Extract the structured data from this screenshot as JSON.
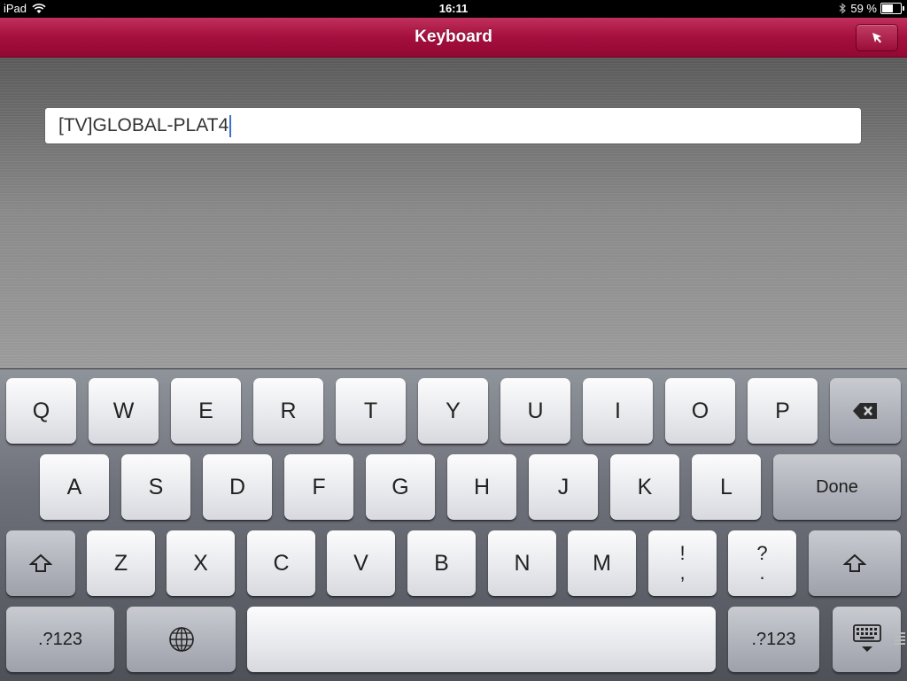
{
  "status_bar": {
    "device": "iPad",
    "time": "16:11",
    "battery_percent": "59 %",
    "battery_level": 0.59,
    "icons": [
      "wifi-icon",
      "bluetooth-icon",
      "battery-icon"
    ]
  },
  "title_bar": {
    "title": "Keyboard",
    "accent": "#a40f3e",
    "pointer_button_icon": "cursor-arrow-icon"
  },
  "text_field": {
    "value": "[TV]GLOBAL-PLAT4"
  },
  "keyboard": {
    "row1": [
      "Q",
      "W",
      "E",
      "R",
      "T",
      "Y",
      "U",
      "I",
      "O",
      "P"
    ],
    "row2": [
      "A",
      "S",
      "D",
      "F",
      "G",
      "H",
      "J",
      "K",
      "L"
    ],
    "done": "Done",
    "row3": [
      "Z",
      "X",
      "C",
      "V",
      "B",
      "N",
      "M"
    ],
    "exclaim_top": "!",
    "exclaim_bottom": ",",
    "question_top": "?",
    "question_bottom": ".",
    "numbers_left": ".?123",
    "numbers_right": ".?123",
    "icons": [
      "backspace-icon",
      "shift-icon",
      "globe-icon",
      "hide-keyboard-icon"
    ]
  }
}
